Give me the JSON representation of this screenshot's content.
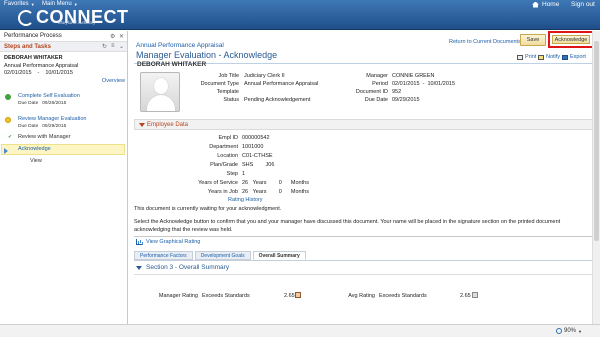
{
  "topbar": {
    "favorites": "Favorites",
    "main_menu": "Main Menu",
    "brand": "CONNECT",
    "brand_sub": "Maryland Judiciary",
    "home": "Home",
    "sign_out": "Sign out"
  },
  "left": {
    "header": "Performance Process",
    "steps_header": "Steps and Tasks",
    "employee_name": "DEBORAH WHITAKER",
    "doc_type": "Annual Performance Appraisal",
    "period_start": "02/01/2015",
    "period_sep": "-",
    "period_end": "10/01/2015",
    "overview": "Overview",
    "steps": [
      {
        "label": "Complete Self Evaluation",
        "due_label": "Due Date",
        "due": "09/26/2015"
      },
      {
        "label": "Review Manager Evaluation",
        "due_label": "Due Date",
        "due": "09/29/2015"
      }
    ],
    "substeps": [
      "Review with Manager",
      "Acknowledge",
      "View"
    ]
  },
  "main": {
    "breadcrumb": "Annual Performance Appraisal",
    "title": "Manager Evaluation - Acknowledge",
    "return_link": "Return to Current Documents",
    "save": "Save",
    "acknowledge": "Acknowledge",
    "tools": {
      "print": "Print",
      "notify": "Notify",
      "export": "Export"
    },
    "employee_name": "DEBORAH WHITAKER",
    "header_fields_left": [
      {
        "label": "Job Title",
        "value": "Judiciary Clerk II"
      },
      {
        "label": "Document Type",
        "value": "Annual Performance Appraisal"
      },
      {
        "label": "Template",
        "value": ""
      },
      {
        "label": "Status",
        "value": "Pending Acknowledgement"
      }
    ],
    "header_fields_right": [
      {
        "label": "Manager",
        "value": "CONNIE GREEN"
      },
      {
        "label": "Period",
        "value": "02/01/2015  -  10/01/2015"
      },
      {
        "label": "Document ID",
        "value": "952"
      },
      {
        "label": "Due Date",
        "value": "09/29/2015"
      }
    ],
    "employee_data_section": "Employee Data",
    "employee_data": [
      {
        "label": "Empl ID",
        "value": "000000542"
      },
      {
        "label": "Department",
        "value": "1001000"
      },
      {
        "label": "Location",
        "value": "C01-CTHSE"
      },
      {
        "label": "Plan/Grade",
        "value": "SHS        J06"
      },
      {
        "label": "Step",
        "value": "1"
      },
      {
        "label": "Years of Service",
        "value": "26   Years        0      Months"
      },
      {
        "label": "Years in Job",
        "value": "26   Years        0      Months"
      }
    ],
    "rating_history": "Rating History",
    "para1": "This document is currently waiting for your acknowledgment.",
    "para2": "Select the Acknowledge button to confirm that you and your manager have discussed this document. Your name will be placed in the signature section on the printed document acknowledging that the review was held.",
    "view_graphical": "View Graphical Rating",
    "tabs": [
      "Performance Factors",
      "Development Goals",
      "Overall Summary"
    ],
    "section3": "Section 3 - Overall Summary",
    "manager_rating_label": "Manager Rating",
    "manager_rating_text": "Exceeds Standards",
    "manager_rating_value": "2.65",
    "avg_rating_label": "Avg Rating",
    "avg_rating_text": "Exceeds Standards",
    "avg_rating_value": "2.65"
  },
  "status": {
    "zoom": "90%"
  }
}
